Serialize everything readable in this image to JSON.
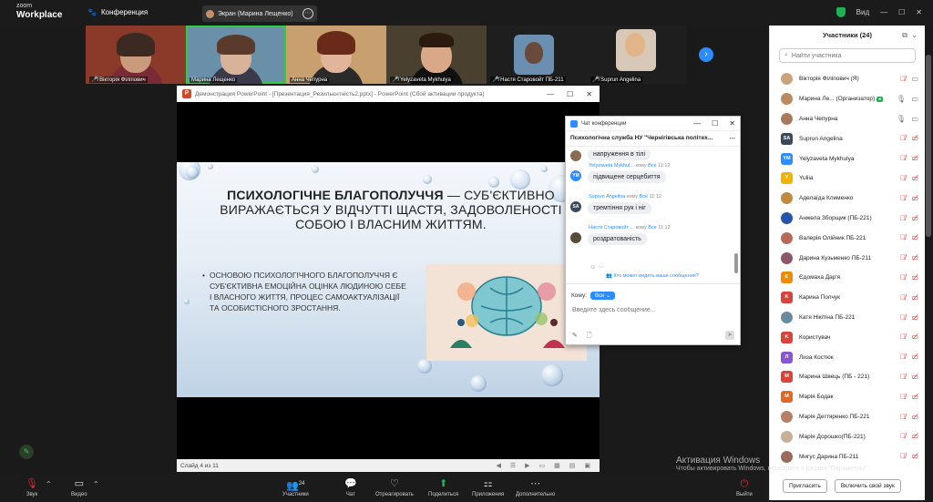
{
  "topbar": {
    "logo_line1": "zoom",
    "logo_line2": "Workplace",
    "conference_tab": "Конференция",
    "screen_tab": "Экран (Марина Лещенко)",
    "view_label": "Вид"
  },
  "videos": [
    {
      "name": "Вікторія Філіпович",
      "muted": true
    },
    {
      "name": "Марина Лещенко",
      "muted": false
    },
    {
      "name": "Анна Чепурна",
      "muted": false
    },
    {
      "name": "Yelyzaveta Mykhulya",
      "muted": true
    },
    {
      "name": "Настя Старовойт ПБ-211",
      "muted": true
    },
    {
      "name": "Suprun Angelina",
      "muted": true
    }
  ],
  "ppt": {
    "title": "Демонстрация PowerPoint - [Презентация_Резильєнтність2.pptx] - PowerPoint (Сбой активации продукта)",
    "heading_bold": "Психологічне благополуччя",
    "heading_rest": " — суб'єктивно виражається у відчутті щастя, задоволеності собою і власним життям.",
    "body": "Основою психологічного благополуччя є суб'єктивна емоційна оцінка людиною себе і власного життя, процес самоактуалізації та особистісного зростання.",
    "status": "Слайд 4 из 11"
  },
  "chat": {
    "window_title": "Чат конференции",
    "conversation_title": "Психологічна служба НУ \"Чернігівська політех...",
    "messages": [
      {
        "initials": "",
        "color": "#8a6a50",
        "header": "",
        "time": "",
        "text": "напруження в тілі"
      },
      {
        "initials": "YM",
        "color": "#2d8cff",
        "sender": "Yelyzaveta Mykhul...",
        "to": "кому",
        "everyone": "Все",
        "time": "11:12",
        "text": "підвищене серцебиття"
      },
      {
        "initials": "SA",
        "color": "#3a4a5a",
        "sender": "Suprun Angelina",
        "to": "кому",
        "everyone": "Все",
        "time": "11:12",
        "text": "тремтіння рук і ніг"
      },
      {
        "initials": "",
        "color": "#5a4a3a",
        "sender": "Настя Старовойт ...",
        "to": "кому",
        "everyone": "Все",
        "time": "11:12",
        "text": "роздратованість"
      }
    ],
    "notice": "Кто может видеть ваши сообщения?",
    "to_label": "Кому:",
    "to_value": "Все",
    "input_placeholder": "Введите здесь сообщение..."
  },
  "participants": {
    "title": "Участники (24)",
    "search_placeholder": "Найти участника",
    "list": [
      {
        "name": "Вікторія Філіпович (Я)",
        "initials": "",
        "color": "#c9a27e",
        "mic": "off",
        "cam": "on"
      },
      {
        "name": "Марина Ле... (Организатор)",
        "initials": "",
        "color": "#b9895f",
        "mic": "on",
        "cam": "on",
        "badge": "●"
      },
      {
        "name": "Анна Чепурна",
        "initials": "",
        "color": "#a77a5c",
        "mic": "on",
        "cam": "on"
      },
      {
        "name": "Suprun Angelina",
        "initials": "SA",
        "color": "#3a4a5a",
        "mic": "off",
        "cam": "off"
      },
      {
        "name": "Yelyzaveta Mykhulya",
        "initials": "YM",
        "color": "#2d8cff",
        "mic": "off",
        "cam": "off"
      },
      {
        "name": "Yuliia",
        "initials": "Y",
        "color": "#f0b400",
        "mic": "off",
        "cam": "off"
      },
      {
        "name": "Аделаїда Клименко",
        "initials": "",
        "color": "#c08a40",
        "mic": "off",
        "cam": "off"
      },
      {
        "name": "Анжела Зборщик (ПБ-221)",
        "initials": "",
        "color": "#2255aa",
        "mic": "off",
        "cam": "off"
      },
      {
        "name": "Валерія Олійник ПБ-221",
        "initials": "",
        "color": "#b56b5b",
        "mic": "off",
        "cam": "off"
      },
      {
        "name": "Дарина Кузьменко ПБ-211",
        "initials": "",
        "color": "#8b5a6a",
        "mic": "off",
        "cam": "off"
      },
      {
        "name": "Єдомаха Дар'я",
        "initials": "Є",
        "color": "#f08a00",
        "mic": "off",
        "cam": "off"
      },
      {
        "name": "Карина Попчук",
        "initials": "K",
        "color": "#d9433a",
        "mic": "off",
        "cam": "off"
      },
      {
        "name": "Катя Нікітіна ПБ-221",
        "initials": "",
        "color": "#6a8aa0",
        "mic": "off",
        "cam": "off"
      },
      {
        "name": "Користувач",
        "initials": "K",
        "color": "#d9433a",
        "mic": "off",
        "cam": "off"
      },
      {
        "name": "Лиза Костюк",
        "initials": "Л",
        "color": "#8a55d0",
        "mic": "off",
        "cam": "off"
      },
      {
        "name": "Марина Швець (ПБ - 221)",
        "initials": "M",
        "color": "#d9433a",
        "mic": "off",
        "cam": "off"
      },
      {
        "name": "Марія Бодак",
        "initials": "M",
        "color": "#e0682a",
        "mic": "off",
        "cam": "off"
      },
      {
        "name": "Марія Дегтяренко ПБ-221",
        "initials": "",
        "color": "#b77f66",
        "mic": "off",
        "cam": "off"
      },
      {
        "name": "Марія Дорошко(ПБ-221)",
        "initials": "",
        "color": "#c7b099",
        "mic": "off",
        "cam": "off"
      },
      {
        "name": "Мигус Дарина ПБ-211",
        "initials": "",
        "color": "#9a6a5a",
        "mic": "off",
        "cam": "off"
      }
    ],
    "invite": "Пригласить",
    "unmute_self": "Включить свой звук"
  },
  "bottombar": {
    "audio": "Звук",
    "video": "Видео",
    "participants": "Участники",
    "participants_count": "24",
    "chat": "Чат",
    "react": "Отреагировать",
    "share": "Поделиться",
    "apps": "Приложения",
    "more": "Дополнительно",
    "leave": "Выйти"
  },
  "watermark": {
    "line1": "Активация Windows",
    "line2": "Чтобы активировать Windows, перейдите в раздел \"Параметры\"."
  }
}
